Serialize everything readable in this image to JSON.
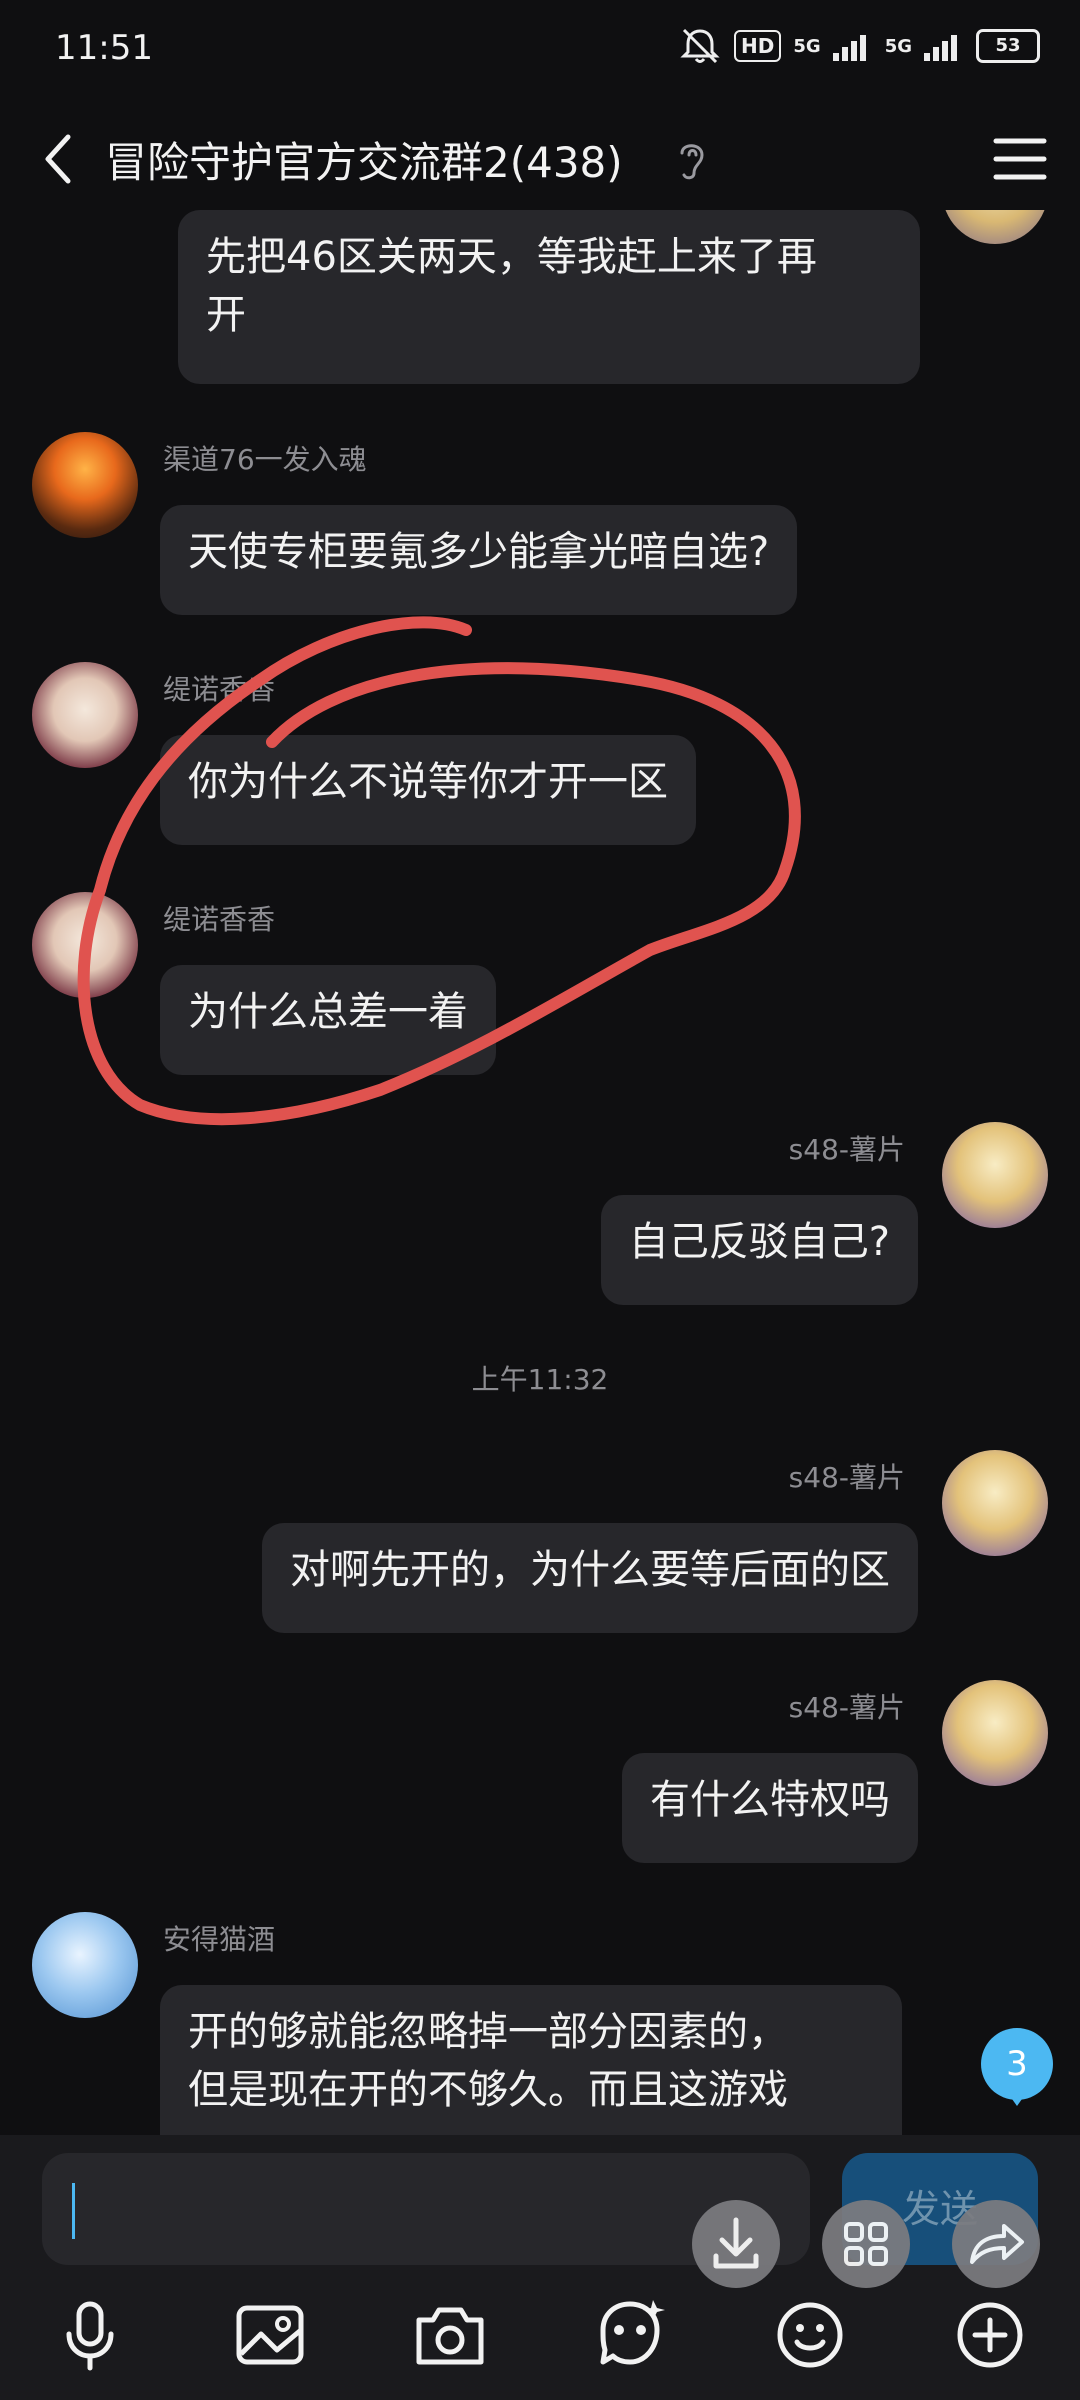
{
  "status_bar": {
    "time": "11:51",
    "hd_label": "HD",
    "network_1": "5G",
    "network_2": "5G",
    "battery": "53"
  },
  "header": {
    "title": "冒险守护官方交流群2(438)"
  },
  "messages": [
    {
      "side": "right",
      "text_lines": [
        "先把46区关两天，等我赶上来了再",
        "开"
      ]
    },
    {
      "side": "left",
      "sender": "渠道76一发入魂",
      "text": "天使专柜要氪多少能拿光暗自选?"
    },
    {
      "side": "left",
      "sender": "缇诺香香",
      "text": "你为什么不说等你才开一区"
    },
    {
      "side": "left",
      "sender": "缇诺香香",
      "text": "为什么总差一着"
    },
    {
      "side": "right",
      "sender": "s48-薯片",
      "text": "自己反驳自己?"
    },
    {
      "side": "right",
      "sender": "s48-薯片",
      "text": "对啊先开的，为什么要等后面的区"
    },
    {
      "side": "right",
      "sender": "s48-薯片",
      "text": "有什么特权吗"
    },
    {
      "side": "left",
      "sender": "安得猫酒",
      "text_lines": [
        "开的够就能忽略掉一部分因素的，",
        "但是现在开的不够久。而且这游戏"
      ]
    }
  ],
  "timestamp": "上午11:32",
  "unread_count": "3",
  "input": {
    "value": "",
    "send_label": "发送"
  },
  "colors": {
    "background": "#0f0f11",
    "bubble": "#27272b",
    "accent": "#4cb8f2",
    "annotation_stroke": "#e0534f"
  },
  "icons": {
    "toolbar": [
      "microphone-icon",
      "image-icon",
      "camera-icon",
      "sticker-icon",
      "emoji-icon",
      "plus-icon"
    ],
    "floating": [
      "download-icon",
      "grid-icon",
      "share-icon"
    ]
  }
}
